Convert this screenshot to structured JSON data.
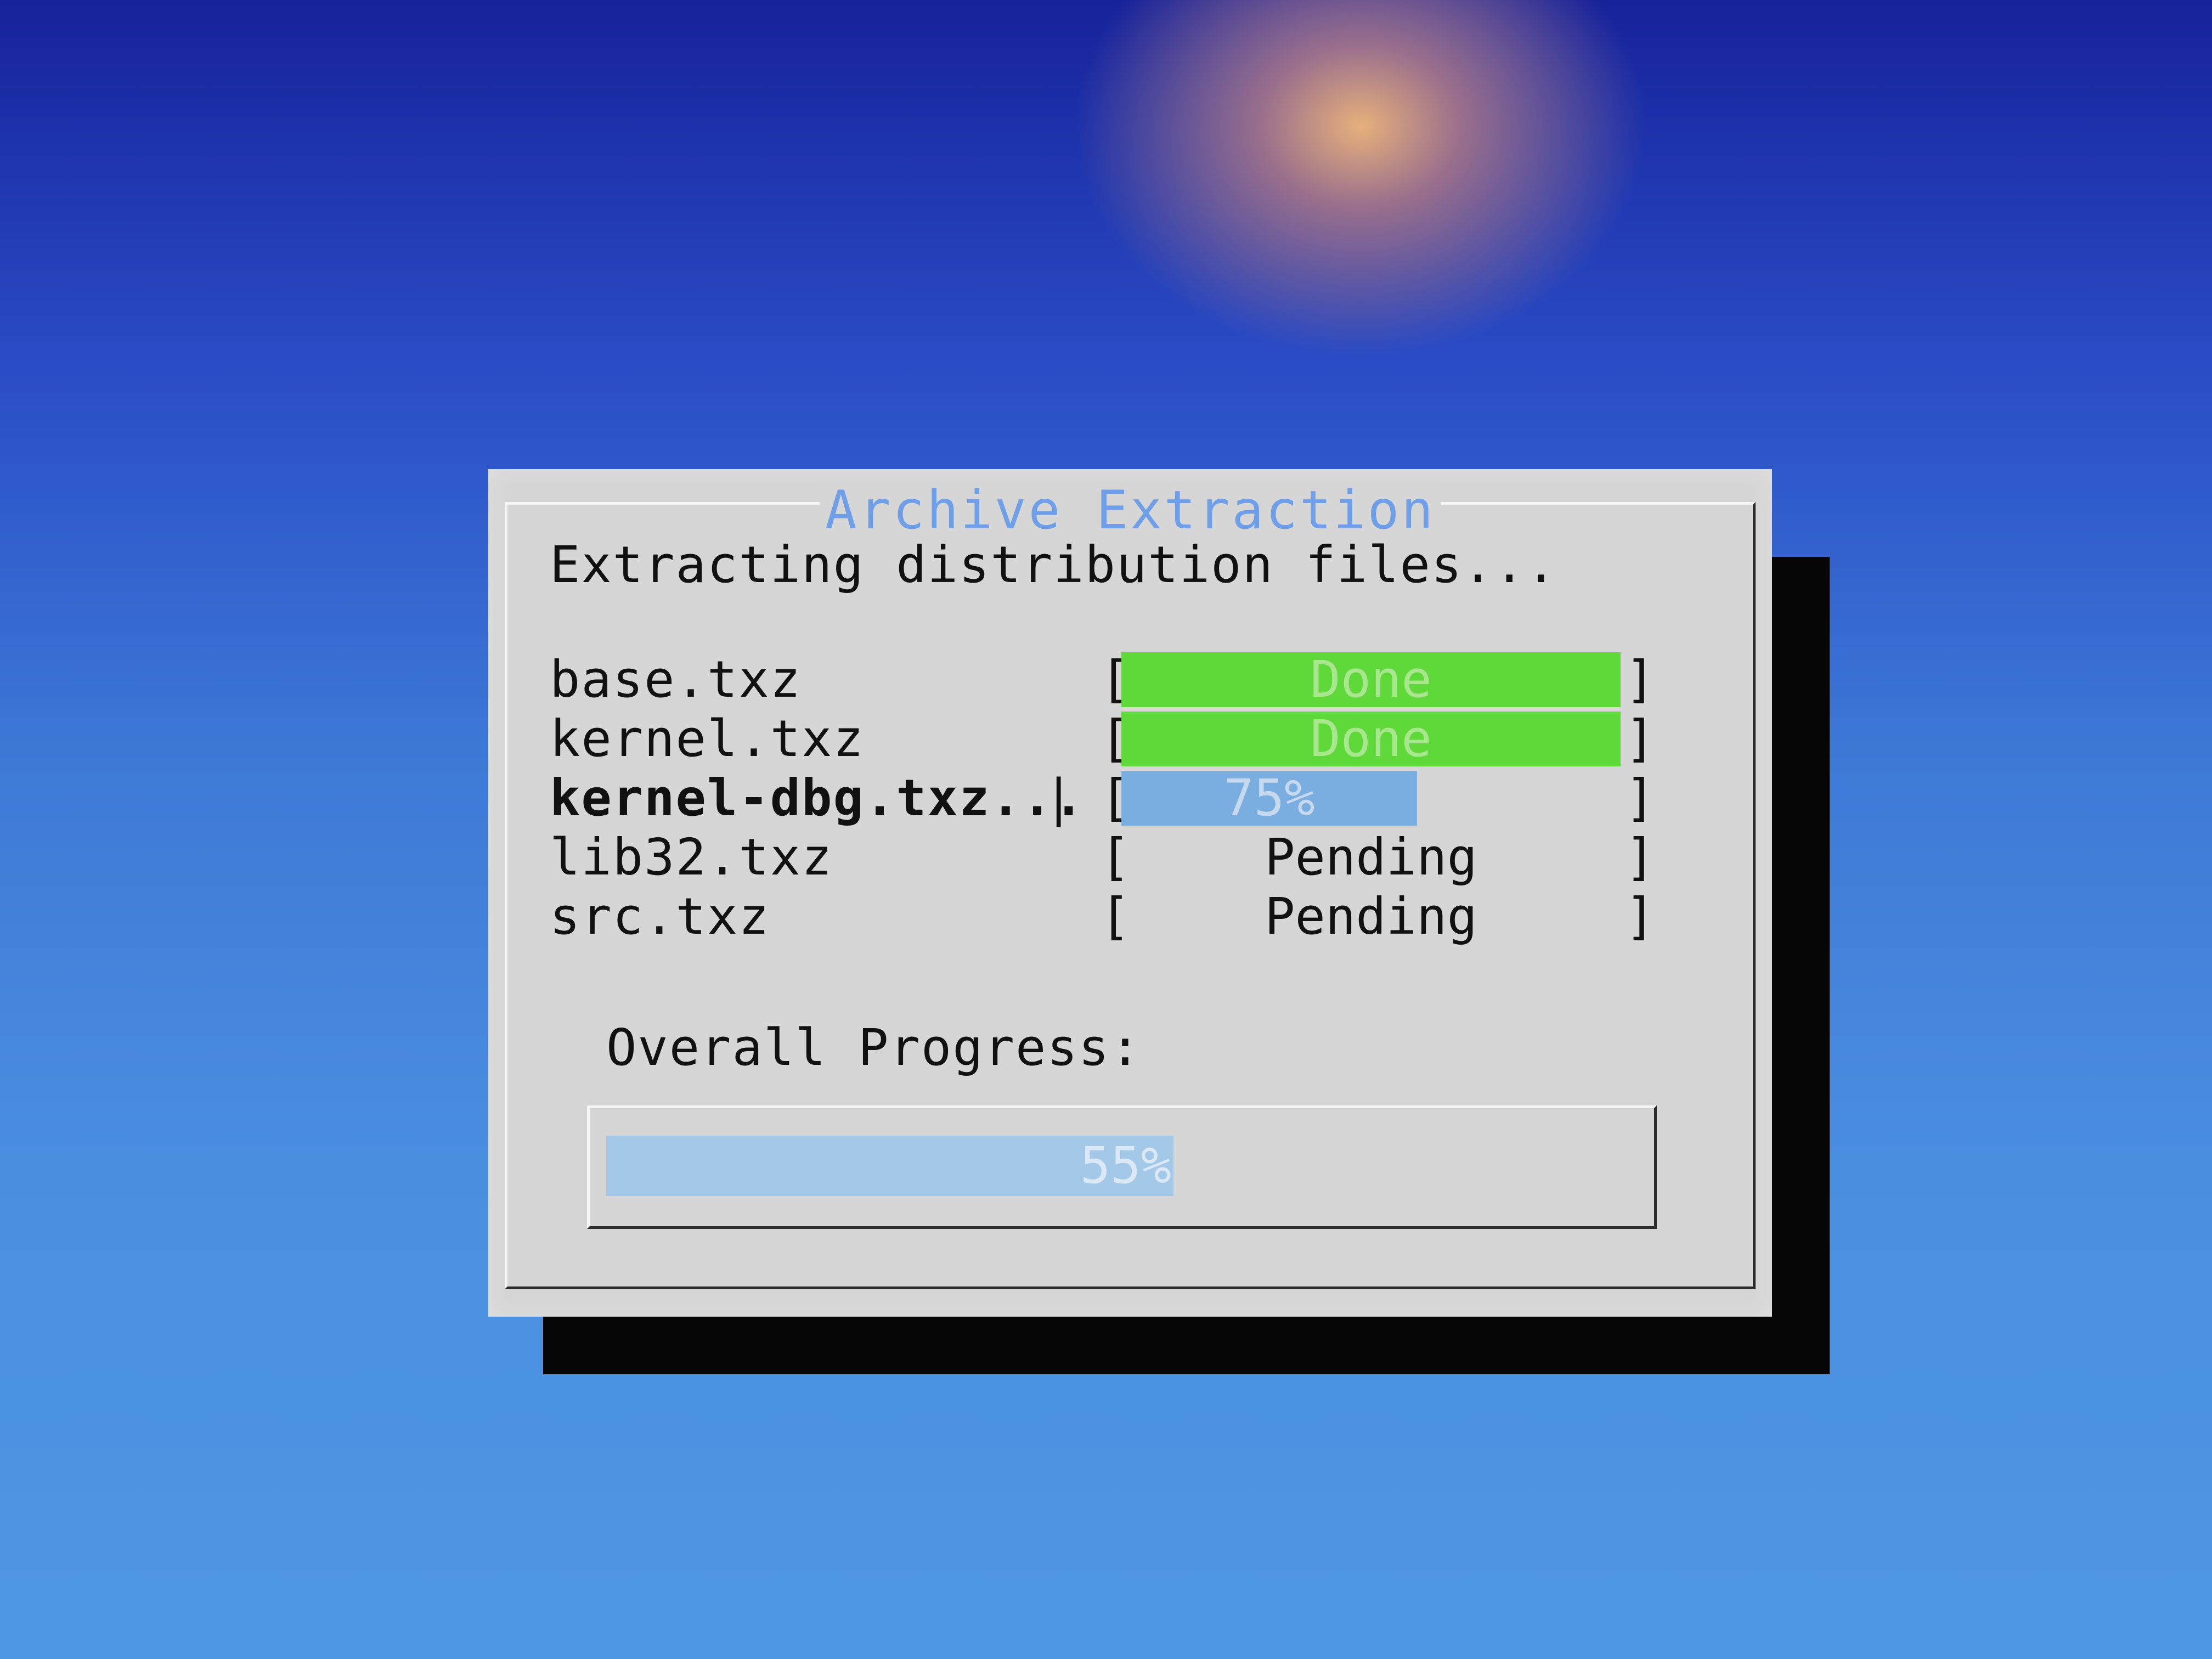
{
  "dialog": {
    "title": "Archive Extraction",
    "message": "Extracting distribution files..."
  },
  "files": [
    {
      "name": "base.txz",
      "status": "Done",
      "state": "done"
    },
    {
      "name": "kernel.txz",
      "status": "Done",
      "state": "done"
    },
    {
      "name": "kernel-dbg.txz...",
      "status": "75%",
      "state": "active",
      "progress": 0.75,
      "spinner": "|"
    },
    {
      "name": "lib32.txz",
      "status": "Pending",
      "state": "pending"
    },
    {
      "name": "src.txz",
      "status": "Pending",
      "state": "pending"
    }
  ],
  "brackets": {
    "left": "[",
    "right": "]"
  },
  "overall": {
    "label": "Overall Progress:",
    "percent_text": "55%",
    "progress": 0.55
  },
  "colors": {
    "done": "#5fd93a",
    "progress": "#7aaee0",
    "overall_progress": "#a4c8e8",
    "title": "#6f9fe8",
    "dialog_bg": "#d6d6d6"
  }
}
